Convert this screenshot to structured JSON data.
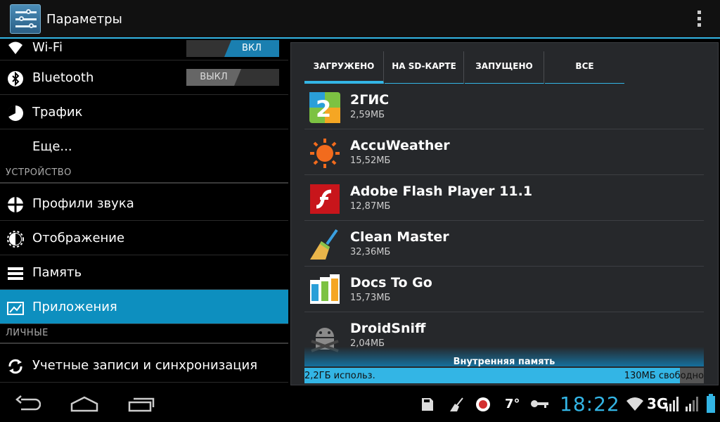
{
  "actionbar": {
    "title": "Параметры"
  },
  "settings": {
    "wifi": {
      "label": "Wi-Fi",
      "toggle": "ВКЛ"
    },
    "bluetooth": {
      "label": "Bluetooth",
      "toggle": "ВЫКЛ"
    },
    "traffic": {
      "label": "Трафик"
    },
    "more": {
      "label": "Еще..."
    },
    "section_device": "УСТРОЙСТВО",
    "sound": {
      "label": "Профили звука"
    },
    "display": {
      "label": "Отображение"
    },
    "memory": {
      "label": "Память"
    },
    "apps": {
      "label": "Приложения"
    },
    "section_personal": "ЛИЧНЫЕ",
    "accounts": {
      "label": "Учетные записи и синхронизация"
    }
  },
  "tabs": [
    "ЗАГРУЖЕНО",
    "НА SD-КАРТЕ",
    "ЗАПУЩЕНО",
    "ВСЕ"
  ],
  "apps": [
    {
      "name": "2ГИС",
      "size": "2,59МБ",
      "icon": "2gis-icon"
    },
    {
      "name": "AccuWeather",
      "size": "15,52МБ",
      "icon": "accuweather-icon"
    },
    {
      "name": "Adobe Flash Player 11.1",
      "size": "12,87МБ",
      "icon": "flash-icon"
    },
    {
      "name": "Clean Master",
      "size": "32,36МБ",
      "icon": "broom-icon"
    },
    {
      "name": "Docs To Go",
      "size": "15,73МБ",
      "icon": "docs-icon"
    },
    {
      "name": "DroidSniff",
      "size": "2,04МБ",
      "icon": "android-icon"
    }
  ],
  "storage": {
    "title": "Внутренняя память",
    "used": "2,2ГБ использ.",
    "free": "130МБ свободно",
    "used_fraction": 0.94
  },
  "statusbar": {
    "notif_number": "7°",
    "clock": "18:22",
    "network": "3G"
  },
  "colors": {
    "accent": "#33b5e5",
    "selected": "#0d8fbf"
  }
}
